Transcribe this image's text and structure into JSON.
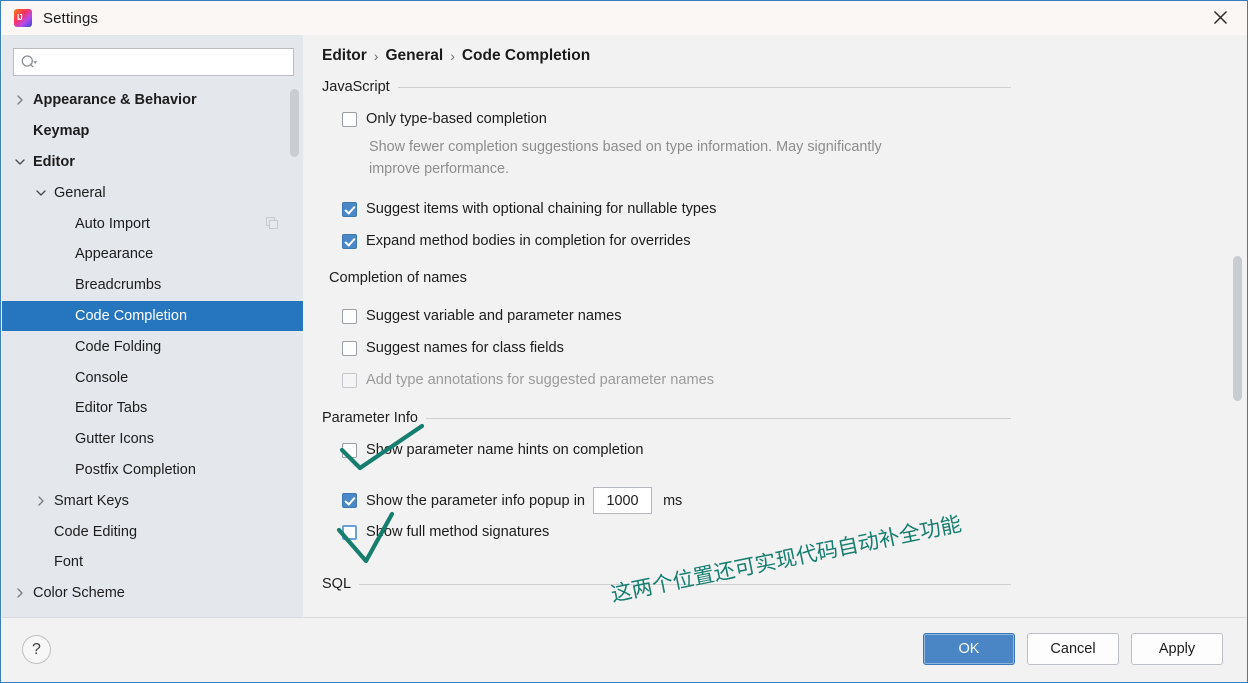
{
  "window": {
    "title": "Settings",
    "app_icon": "intellij-idea-icon",
    "close_icon": "close-icon"
  },
  "sidebar": {
    "search": {
      "placeholder": "",
      "value": "",
      "icon": "search-icon"
    },
    "items": [
      {
        "label": "Appearance & Behavior",
        "indent": 0,
        "arrow": "right",
        "bold": true,
        "selected": false
      },
      {
        "label": "Keymap",
        "indent": 0,
        "arrow": "none",
        "bold": true,
        "selected": false
      },
      {
        "label": "Editor",
        "indent": 0,
        "arrow": "down",
        "bold": true,
        "selected": false
      },
      {
        "label": "General",
        "indent": 1,
        "arrow": "down",
        "bold": false,
        "selected": false
      },
      {
        "label": "Auto Import",
        "indent": 2,
        "arrow": "none",
        "bold": false,
        "selected": false,
        "extra_icon": "copy-icon"
      },
      {
        "label": "Appearance",
        "indent": 2,
        "arrow": "none",
        "bold": false,
        "selected": false
      },
      {
        "label": "Breadcrumbs",
        "indent": 2,
        "arrow": "none",
        "bold": false,
        "selected": false
      },
      {
        "label": "Code Completion",
        "indent": 2,
        "arrow": "none",
        "bold": false,
        "selected": true
      },
      {
        "label": "Code Folding",
        "indent": 2,
        "arrow": "none",
        "bold": false,
        "selected": false
      },
      {
        "label": "Console",
        "indent": 2,
        "arrow": "none",
        "bold": false,
        "selected": false
      },
      {
        "label": "Editor Tabs",
        "indent": 2,
        "arrow": "none",
        "bold": false,
        "selected": false
      },
      {
        "label": "Gutter Icons",
        "indent": 2,
        "arrow": "none",
        "bold": false,
        "selected": false
      },
      {
        "label": "Postfix Completion",
        "indent": 2,
        "arrow": "none",
        "bold": false,
        "selected": false
      },
      {
        "label": "Smart Keys",
        "indent": 1,
        "arrow": "right",
        "bold": false,
        "selected": false
      },
      {
        "label": "Code Editing",
        "indent": 1,
        "arrow": "none",
        "bold": false,
        "selected": false
      },
      {
        "label": "Font",
        "indent": 1,
        "arrow": "none",
        "bold": false,
        "selected": false
      },
      {
        "label": "Color Scheme",
        "indent": 0,
        "arrow": "right",
        "bold": false,
        "selected": false
      }
    ]
  },
  "main": {
    "breadcrumb": [
      "Editor",
      "General",
      "Code Completion"
    ],
    "breadcrumb_separator": "›",
    "groups": {
      "javascript": "JavaScript",
      "completion_of_names": "Completion of names",
      "parameter_info": "Parameter Info",
      "sql": "SQL"
    },
    "options": {
      "only_type_based": {
        "label": "Only type-based completion",
        "checked": false,
        "disabled": false
      },
      "only_type_based_desc": "Show fewer completion suggestions based on type information. May significantly improve performance.",
      "optional_chaining": {
        "label": "Suggest items with optional chaining for nullable types",
        "checked": true,
        "disabled": false
      },
      "expand_method_bodies": {
        "label": "Expand method bodies in completion for overrides",
        "checked": true,
        "disabled": false
      },
      "suggest_variable_names": {
        "label": "Suggest variable and parameter names",
        "checked": false,
        "disabled": false
      },
      "suggest_class_field_names": {
        "label": "Suggest names for class fields",
        "checked": false,
        "disabled": false
      },
      "add_type_annotations": {
        "label": "Add type annotations for suggested parameter names",
        "checked": false,
        "disabled": true
      },
      "param_name_hints": {
        "label": "Show parameter name hints on completion",
        "checked": false,
        "disabled": false
      },
      "param_info_popup": {
        "label": "Show the parameter info popup in",
        "checked": true,
        "disabled": false,
        "delay_value": "1000",
        "unit": "ms"
      },
      "full_method_signatures": {
        "label": "Show full method signatures",
        "checked": false,
        "disabled": false
      }
    }
  },
  "annotations": {
    "note_text": "这两个位置还可实现代码自动补全功能",
    "color": "#167e6e",
    "marks": [
      "check-mark-1",
      "check-mark-2"
    ]
  },
  "footer": {
    "help_label": "?",
    "ok_label": "OK",
    "cancel_label": "Cancel",
    "apply_label": "Apply"
  },
  "colors": {
    "accent_blue": "#2675bf",
    "checkbox_blue": "#4a88c7",
    "sidebar_bg": "#e4e8ec",
    "main_bg": "#f2f2f2",
    "annotation_teal": "#167e6e"
  }
}
